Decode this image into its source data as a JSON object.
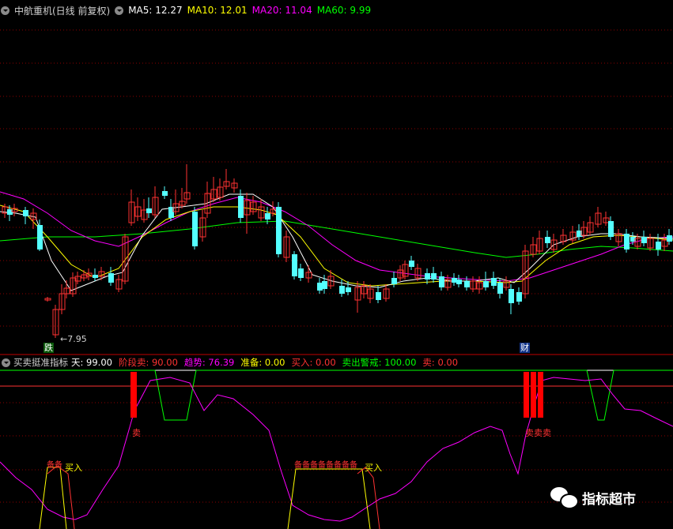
{
  "main_header": {
    "stock_title": "中航重机(日线 前复权)",
    "ma5": "MA5: 12.27",
    "ma10": "MA10: 12.01",
    "ma20": "MA20: 11.04",
    "ma60": "MA60: 9.99"
  },
  "price_annotations": {
    "low_price": "7.95",
    "tag_left": "跌",
    "tag_right": "财"
  },
  "indicator_header": {
    "name": "买卖挺准指标",
    "tian": "天: 99.00",
    "jieduan": "阶段卖: 90.00",
    "qushi": "趋势: 76.39",
    "zhunbei": "准备: 0.00",
    "mairu": "买入: 0.00",
    "maichu_jingjie": "卖出警戒: 100.00",
    "mai": "卖: 0.00"
  },
  "indicator_labels": {
    "sell_a": "卖",
    "sell_b": "卖卖卖",
    "prep_a": "备备",
    "buy_a": "买入",
    "prep_b": "备备备备备备备备",
    "buy_b": "买入"
  },
  "watermark": "指标超市",
  "colors": {
    "up": "#ff3232",
    "down": "#54ffff",
    "ma5": "#ffffff",
    "ma10": "#ffff00",
    "ma20": "#ff00ff",
    "ma60": "#00ff00",
    "grid": "#8b0000",
    "separator": "#c00000"
  },
  "icons": [
    "collapse-circle-icon",
    "wechat-icon"
  ]
}
